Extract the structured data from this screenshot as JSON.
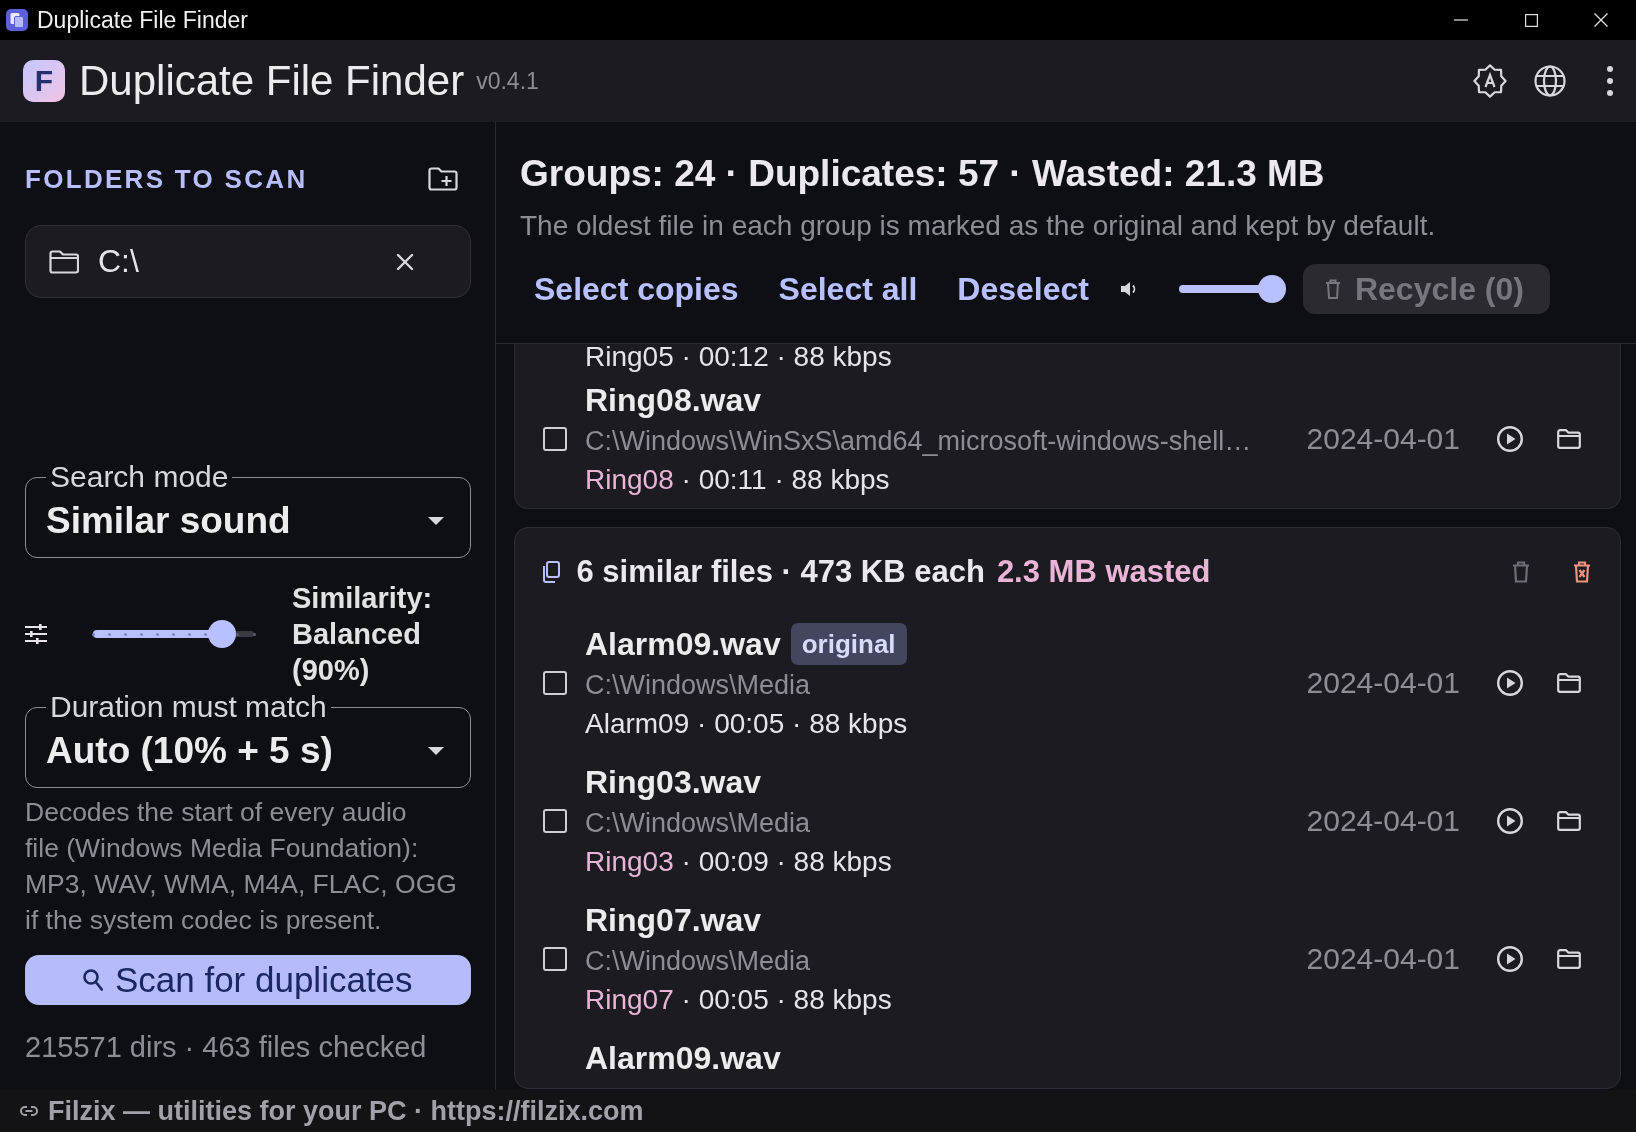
{
  "title_bar": {
    "title": "Duplicate File Finder"
  },
  "app_header": {
    "logo_letter": "F",
    "title": "Duplicate File Finder",
    "version": "v0.4.1"
  },
  "sidebar": {
    "section_title": "FOLDERS TO SCAN",
    "folders": [
      {
        "path": "C:\\"
      }
    ],
    "search_mode": {
      "label": "Search mode",
      "value": "Similar sound"
    },
    "similarity": {
      "level": 0.8,
      "label": "Similarity: Balanced (90%)"
    },
    "duration": {
      "label": "Duration must match",
      "value": "Auto (10% + 5 s)"
    },
    "description": "Decodes the start of every audio\nfile (Windows Media Foundation):\nMP3, WAV, WMA, M4A, FLAC, OGG\nif the system codec is present.",
    "scan_button": "Scan for duplicates",
    "scan_stats": "215571 dirs · 463 files checked"
  },
  "results": {
    "summary": "Groups: 24 · Duplicates: 57 · Wasted: 21.3 MB",
    "hint": "The oldest file in each group is marked as the original and kept by default.",
    "actions": [
      {
        "label": "Select copies"
      },
      {
        "label": "Select all"
      },
      {
        "label": "Deselect"
      }
    ],
    "volume": {
      "level": 1
    },
    "recycle_button": {
      "label": "Recycle (0)",
      "disabled": true
    },
    "groups": [
      {
        "files": [
          {
            "title": "Ring05",
            "title_highlighted": false,
            "details": "· 00:12 · 88 kbps"
          },
          {
            "checked": false,
            "name": "Ring08.wav",
            "path": "C:\\Windows\\WinSxS\\amd64_microsoft-windows-shell…",
            "title": "Ring08",
            "title_highlighted": true,
            "details": "· 00:11 · 88 kbps",
            "date": "2024-04-01"
          }
        ]
      },
      {
        "summary": "6 similar files · 473 KB each",
        "wasted": "2.3 MB wasted",
        "files": [
          {
            "checked": false,
            "name": "Alarm09.wav",
            "badge": "original",
            "path": "C:\\Windows\\Media",
            "title": "Alarm09",
            "title_highlighted": false,
            "details": "· 00:05 · 88 kbps",
            "date": "2024-04-01"
          },
          {
            "checked": false,
            "name": "Ring03.wav",
            "path": "C:\\Windows\\Media",
            "title": "Ring03",
            "title_highlighted": true,
            "details": "· 00:09 · 88 kbps",
            "date": "2024-04-01"
          },
          {
            "checked": false,
            "name": "Ring07.wav",
            "path": "C:\\Windows\\Media",
            "title": "Ring07",
            "title_highlighted": true,
            "details": "· 00:05 · 88 kbps",
            "date": "2024-04-01"
          },
          {
            "name": "Alarm09.wav"
          }
        ]
      }
    ]
  },
  "footer": {
    "text": "Filzix — utilities for your PC · https://filzix.com"
  }
}
